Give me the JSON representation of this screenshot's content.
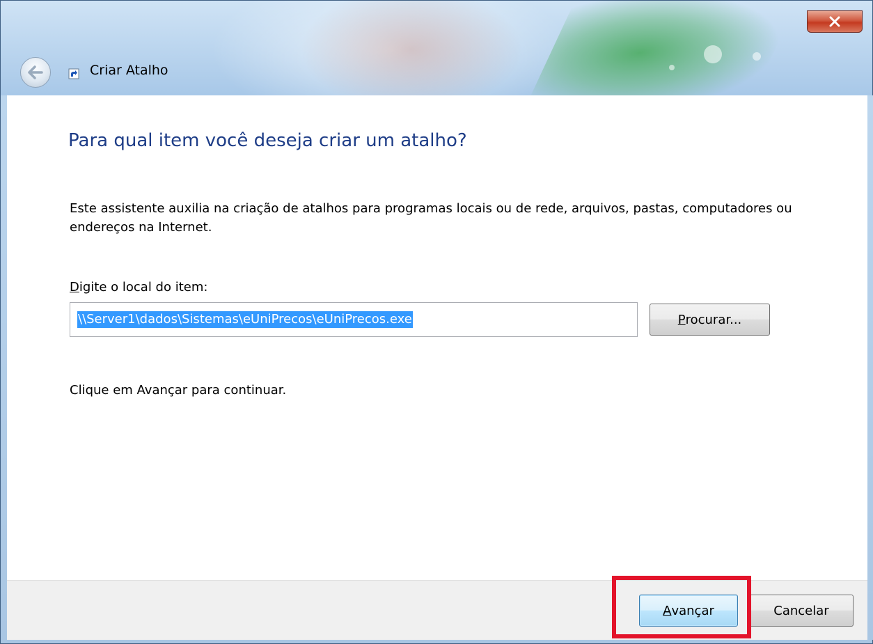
{
  "window": {
    "title": "Criar Atalho",
    "close_glyph": "x"
  },
  "icons": {
    "back": "back-arrow-icon",
    "wizard": "shortcut-icon",
    "close": "close-icon"
  },
  "page": {
    "heading": "Para qual item você deseja criar um atalho?",
    "description": "Este assistente auxilia na criação de atalhos para programas locais ou de rede, arquivos, pastas, computadores ou endereços na Internet.",
    "field_label_accel": "D",
    "field_label_rest": "igite o local do item:",
    "location_value": "\\\\Server1\\dados\\Sistemas\\eUniPrecos\\eUniPrecos.exe",
    "browse_accel": "P",
    "browse_rest": "rocurar...",
    "continue_hint": "Clique em Avançar para continuar."
  },
  "footer": {
    "next_accel": "A",
    "next_rest": "vançar",
    "cancel_label": "Cancelar"
  },
  "colors": {
    "heading": "#1e3d87",
    "selection": "#3399ff",
    "highlight_box": "#e3132a",
    "close_button": "#c53a20"
  }
}
